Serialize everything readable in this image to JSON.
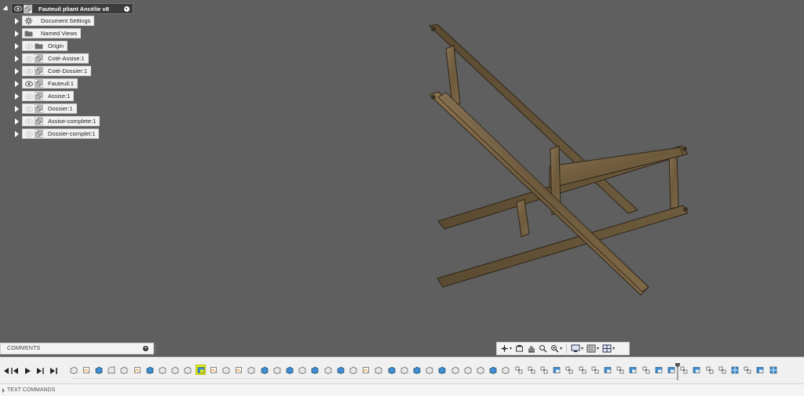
{
  "browser": {
    "root": {
      "label": "Fauteuil pliant  Ancélie v8",
      "visibility_icon": "eye-icon",
      "component_icon": "component-icon",
      "activate_icon": "radio-target-icon"
    },
    "items": [
      {
        "label": "Document Settings",
        "icon": "gear-icon",
        "visible": false,
        "eye": ""
      },
      {
        "label": "Named Views",
        "icon": "folder-icon",
        "visible": false,
        "eye": ""
      },
      {
        "label": "Origin",
        "icon": "folder-icon",
        "visible": false,
        "eye": "eye-hidden-icon"
      },
      {
        "label": "Coté-Assise:1",
        "icon": "component-icon",
        "visible": false,
        "eye": "eye-hidden-icon"
      },
      {
        "label": "Coté-Dossier:1",
        "icon": "component-icon",
        "visible": false,
        "eye": "eye-hidden-icon"
      },
      {
        "label": "Fauteuil:1",
        "icon": "component-icon",
        "visible": true,
        "eye": "eye-icon"
      },
      {
        "label": "Assise:1",
        "icon": "component-icon",
        "visible": false,
        "eye": "eye-hidden-icon"
      },
      {
        "label": "Dossier:1",
        "icon": "component-icon",
        "visible": false,
        "eye": "eye-hidden-icon"
      },
      {
        "label": "Assise-complete:1",
        "icon": "component-icon",
        "visible": false,
        "eye": "eye-hidden-icon"
      },
      {
        "label": "Dossier-complet:1",
        "icon": "component-icon",
        "visible": false,
        "eye": "eye-hidden-icon"
      }
    ]
  },
  "comments": {
    "label": "COMMENTS"
  },
  "navbar": {
    "buttons": [
      "orbit-icon",
      "look-at-icon",
      "pan-icon",
      "zoom-window-icon",
      "zoom-icon",
      "display-settings-icon",
      "grid-icon",
      "viewports-icon"
    ]
  },
  "timeline": {
    "controls": [
      "skip-start-icon",
      "step-back-icon",
      "play-icon",
      "step-forward-icon",
      "skip-end-icon"
    ],
    "features": [
      "extrude",
      "sketch",
      "body",
      "fillet",
      "extrude",
      "sketch",
      "body",
      "extrude",
      "extrude",
      "extrude",
      "move-highlighted",
      "sketch",
      "extrude",
      "sketch",
      "extrude",
      "body",
      "extrude",
      "body",
      "extrude",
      "body",
      "extrude",
      "body",
      "extrude",
      "sketch",
      "extrude",
      "body",
      "extrude",
      "body",
      "extrude",
      "body",
      "extrude",
      "extrude",
      "extrude",
      "body",
      "extrude",
      "joint",
      "joint",
      "joint",
      "move",
      "joint",
      "joint",
      "joint",
      "move",
      "joint",
      "move",
      "joint",
      "move",
      "move",
      "joint",
      "move",
      "joint",
      "joint",
      "rigid-group",
      "joint",
      "move",
      "rigid-group"
    ],
    "highlighted_index": 10
  },
  "text_commands": {
    "label": "TEXT COMMANDS"
  },
  "colors": {
    "viewport": "#5f5f5f",
    "wood": "#7a6545",
    "highlight": "#e7f21a",
    "feature_blue": "#3c8fd6"
  }
}
